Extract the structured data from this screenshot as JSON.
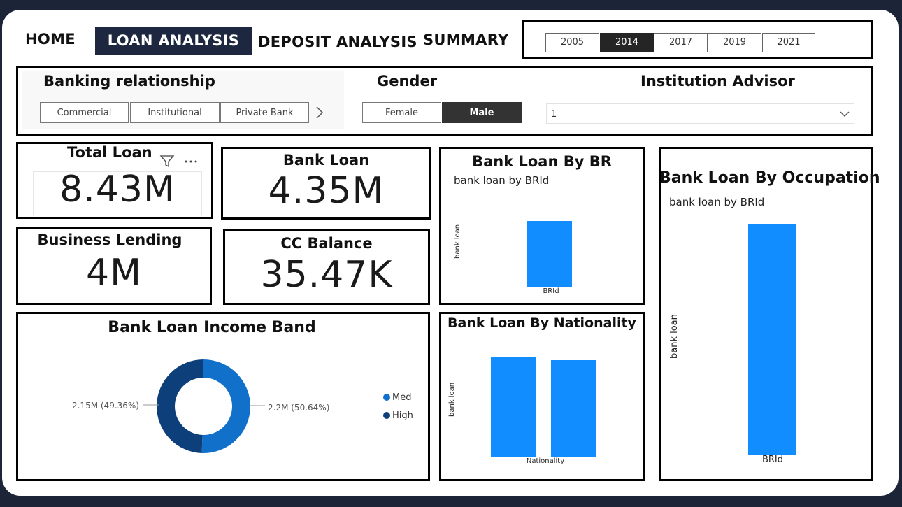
{
  "nav": {
    "home": "HOME",
    "loan_analysis": "LOAN ANALYSIS",
    "deposit_analysis": "DEPOSIT ANALYSIS",
    "summary": "SUMMARY"
  },
  "years": [
    "2005",
    "2014",
    "2017",
    "2019",
    "2021"
  ],
  "selected_year": "2014",
  "slicers": {
    "banking_relationship": {
      "title": "Banking relationship",
      "options": [
        "Commercial",
        "Institutional",
        "Private Bank"
      ],
      "more_icon": "chevron-right-icon"
    },
    "gender": {
      "title": "Gender",
      "options": [
        "Female",
        "Male"
      ],
      "selected": "Male"
    },
    "institution_advisor": {
      "title": "Institution Advisor",
      "value": "1",
      "icon": "chevron-down-icon"
    }
  },
  "kpis": {
    "total_loan": {
      "title": "Total Loan",
      "value": "8.43M",
      "filter_icon": "filter-icon",
      "more_icon": "more-options-icon"
    },
    "bank_loan": {
      "title": "Bank Loan",
      "value": "4.35M"
    },
    "business_lending": {
      "title": "Business Lending",
      "value": "4M"
    },
    "cc_balance": {
      "title": "CC Balance",
      "value": "35.47K"
    }
  },
  "colors": {
    "bar": "#118dff",
    "donut_med": "#1170c9",
    "donut_high": "#0d3f7a",
    "nav_active": "#1e2740"
  },
  "chart_data": [
    {
      "type": "bar",
      "title": "Bank Loan By BR",
      "subtitle": "bank loan by BRId",
      "xlabel": "BRId",
      "ylabel": "bank loan",
      "categories": [
        ""
      ],
      "values": [
        4350000
      ]
    },
    {
      "type": "bar",
      "title": "Bank Loan By Occupation",
      "subtitle": "bank loan by BRId",
      "xlabel": "BRId",
      "ylabel": "bank loan",
      "categories": [
        ""
      ],
      "values": [
        4350000
      ]
    },
    {
      "type": "bar",
      "title": "Bank Loan By Nationality",
      "xlabel": "Nationality",
      "ylabel": "bank loan",
      "categories": [
        "",
        ""
      ],
      "values": [
        2200000,
        2150000
      ]
    },
    {
      "type": "pie",
      "title": "Bank Loan Income Band",
      "legend": [
        "Med",
        "High"
      ],
      "legend_position": "right",
      "slices": [
        {
          "name": "Med",
          "value": 2200000,
          "label": "2.2M (50.64%)",
          "percent": 50.64
        },
        {
          "name": "High",
          "value": 2150000,
          "label": "2.15M (49.36%)",
          "percent": 49.36
        }
      ]
    }
  ]
}
